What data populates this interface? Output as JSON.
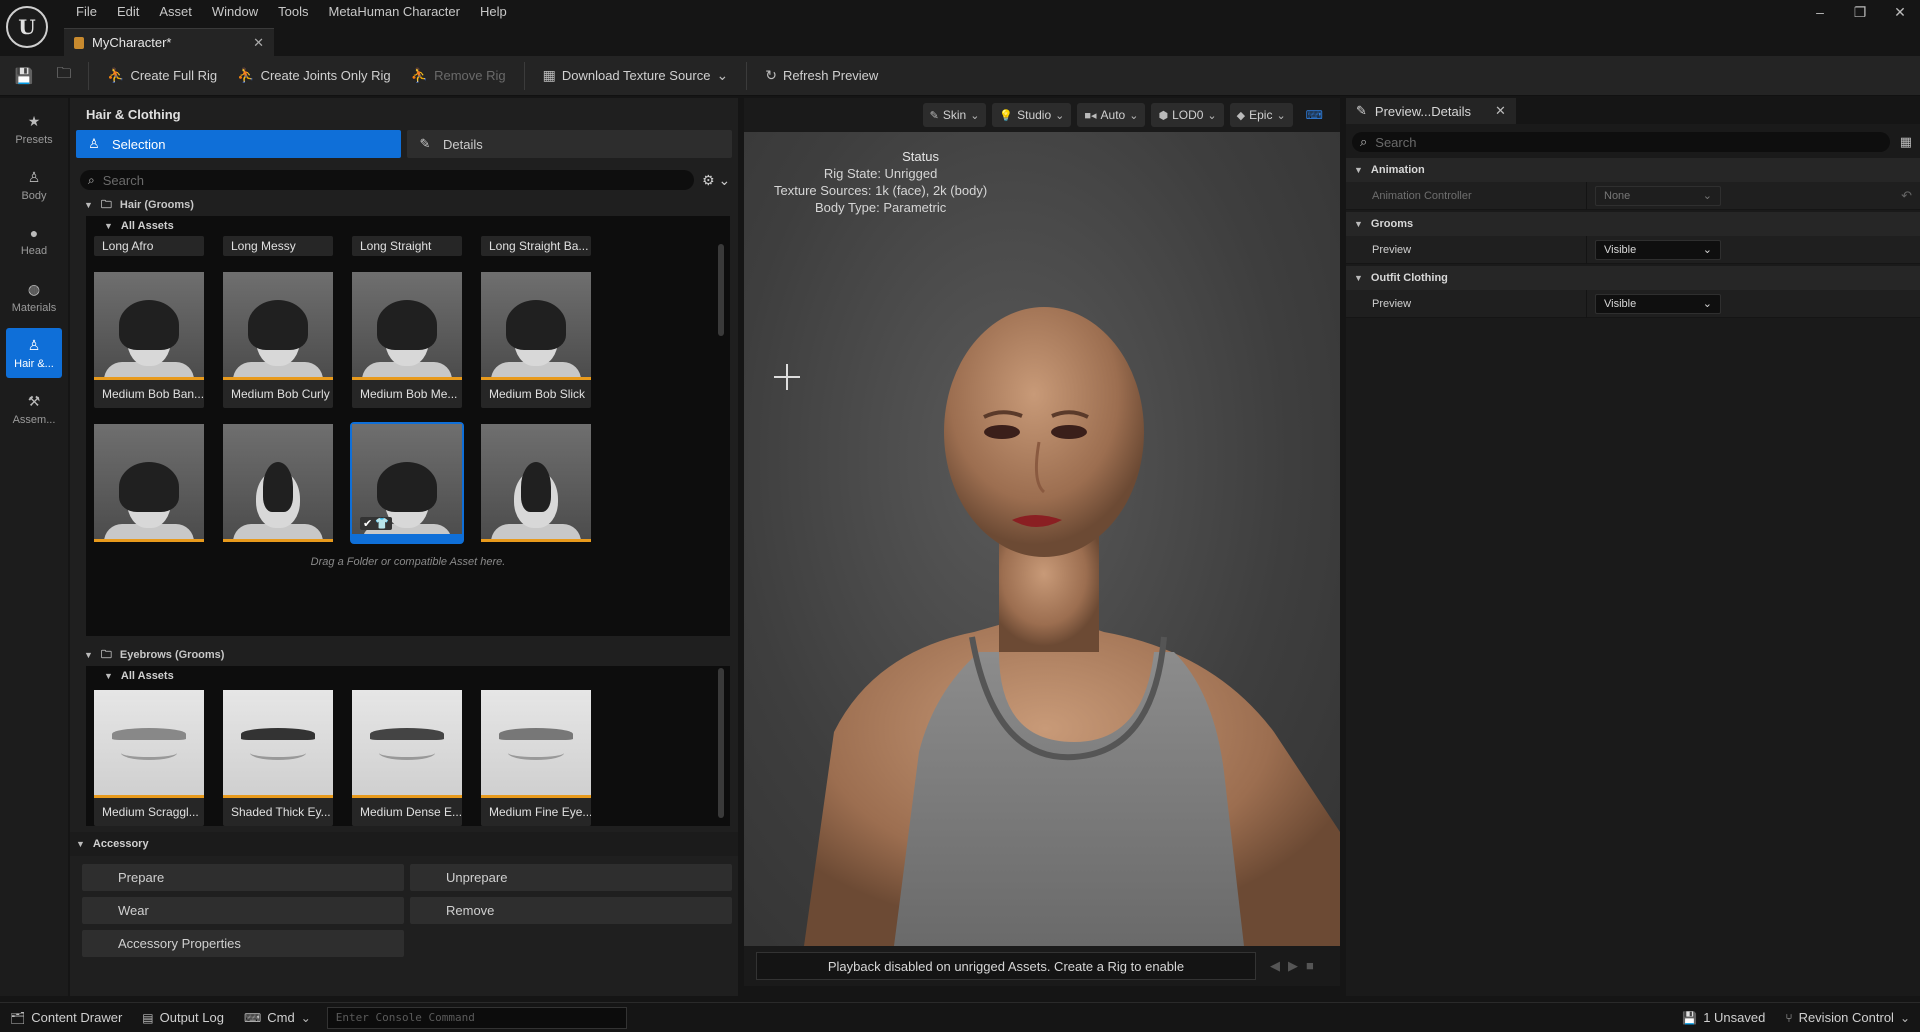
{
  "menu": [
    "File",
    "Edit",
    "Asset",
    "Window",
    "Tools",
    "MetaHuman Character",
    "Help"
  ],
  "document_tab": {
    "title": "MyCharacter*"
  },
  "toolbar": {
    "create_full_rig": "Create Full Rig",
    "create_joints_only_rig": "Create Joints Only Rig",
    "remove_rig": "Remove Rig",
    "download_texture_source": "Download Texture Source",
    "refresh_preview": "Refresh Preview"
  },
  "leftnav": [
    {
      "label": "Presets",
      "icon": "star-icon"
    },
    {
      "label": "Body",
      "icon": "body-icon"
    },
    {
      "label": "Head",
      "icon": "head-icon"
    },
    {
      "label": "Materials",
      "icon": "materials-icon"
    },
    {
      "label": "Hair &...",
      "icon": "hair-icon",
      "active": true
    },
    {
      "label": "Assem...",
      "icon": "assembly-icon"
    }
  ],
  "panel": {
    "title": "Hair & Clothing",
    "tab_selection": "Selection",
    "tab_details": "Details",
    "search_placeholder": "Search",
    "hair_section": "Hair (Grooms)",
    "all_assets": "All Assets",
    "hair_row_top": [
      "Long Afro",
      "Long Messy",
      "Long Straight",
      "Long Straight Ba..."
    ],
    "hair_row_1": [
      "Medium Bob Ban...",
      "Medium Bob Curly",
      "Medium Bob Me...",
      "Medium Bob Slick"
    ],
    "drag_hint": "Drag a Folder or compatible Asset here.",
    "eyebrows_section": "Eyebrows (Grooms)",
    "eyebrows": [
      "Medium Scraggl...",
      "Shaded Thick Ey...",
      "Medium Dense E...",
      "Medium Fine Eye..."
    ],
    "accessory_section": "Accessory",
    "accessory_buttons": {
      "prepare": "Prepare",
      "unprepare": "Unprepare",
      "wear": "Wear",
      "remove": "Remove",
      "properties": "Accessory Properties"
    }
  },
  "viewport": {
    "buttons": {
      "skin": "Skin",
      "studio": "Studio",
      "auto": "Auto",
      "lod": "LOD0",
      "epic": "Epic"
    },
    "status": {
      "title": "Status",
      "rig_state": "Rig State: Unrigged",
      "texture_sources": "Texture Sources: 1k (face), 2k (body)",
      "body_type": "Body Type: Parametric"
    },
    "footer_message": "Playback disabled on unrigged Assets. Create a Rig to enable"
  },
  "details": {
    "tab_title": "Preview...Details",
    "search_placeholder": "Search",
    "categories": {
      "animation": "Animation",
      "grooms": "Grooms",
      "outfit": "Outfit Clothing"
    },
    "rows": {
      "animation_controller_label": "Animation Controller",
      "animation_controller_value": "None",
      "grooms_preview_label": "Preview",
      "grooms_preview_value": "Visible",
      "outfit_preview_label": "Preview",
      "outfit_preview_value": "Visible"
    }
  },
  "statusbar": {
    "content_drawer": "Content Drawer",
    "output_log": "Output Log",
    "cmd": "Cmd",
    "console_placeholder": "Enter Console Command",
    "unsaved": "1 Unsaved",
    "revision_control": "Revision Control"
  },
  "colors": {
    "accent": "#0f6fd8",
    "thumb_bar": "#e89a1c"
  }
}
